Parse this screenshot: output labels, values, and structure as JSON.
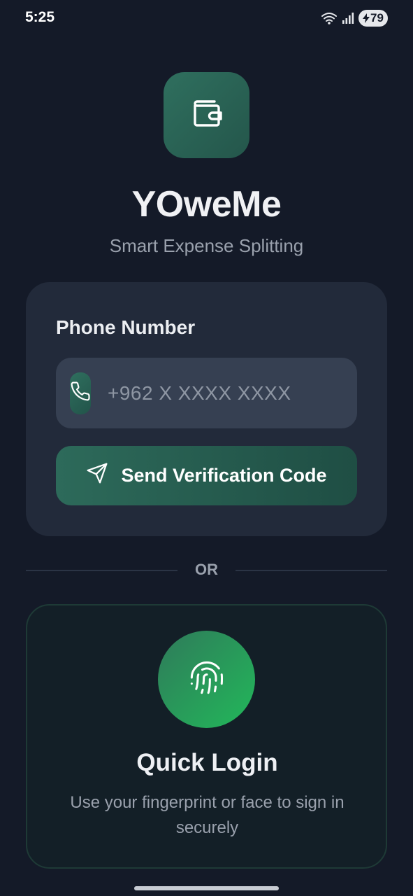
{
  "status_bar": {
    "time": "5:25",
    "battery_level": "79",
    "icons": [
      "wifi-icon",
      "signal-icon",
      "battery-charging-icon"
    ]
  },
  "brand": {
    "logo_icon": "wallet-icon",
    "name": "YOweMe",
    "tagline": "Smart Expense Splitting"
  },
  "phone_login": {
    "label": "Phone Number",
    "input_icon": "phone-icon",
    "input_value": "",
    "input_placeholder": "+962 X XXXX XXXX",
    "send_button_icon": "send-icon",
    "send_button_label": "Send Verification Code"
  },
  "divider": {
    "text": "OR"
  },
  "quick_login": {
    "icon": "fingerprint-icon",
    "title": "Quick Login",
    "description": "Use your fingerprint or face to sign in securely"
  },
  "colors": {
    "background": "#141a28",
    "card": "#222a3a",
    "input": "#364052",
    "accent_dark_green": "#2d6a5a",
    "accent_bright_green": "#22b85a",
    "text_primary": "#eef0f4",
    "text_secondary": "#9aa1ad"
  }
}
